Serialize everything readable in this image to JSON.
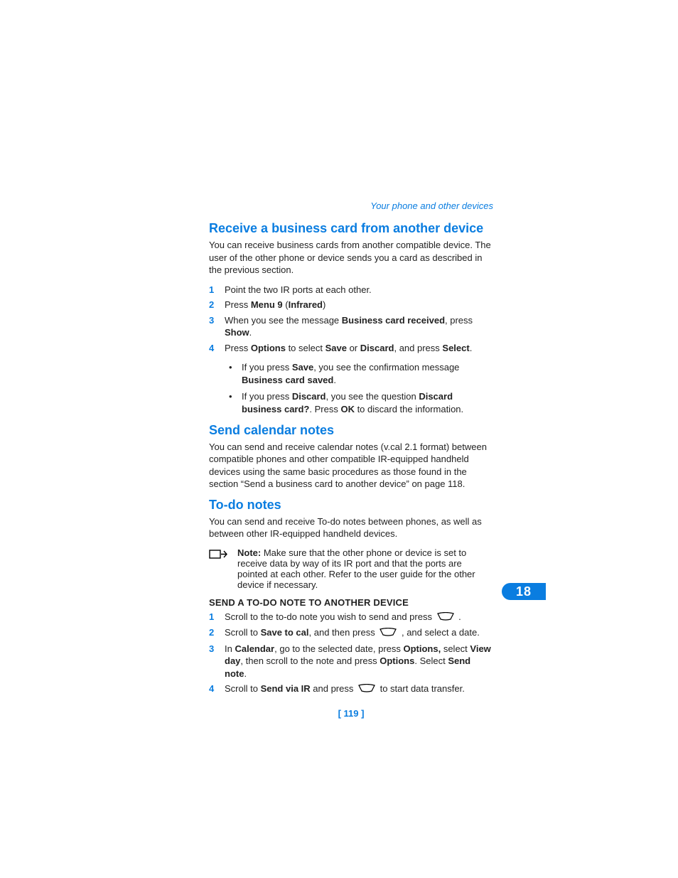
{
  "header": "Your phone and other devices",
  "chapter_badge": "18",
  "page_number": "[ 119 ]",
  "s1": {
    "title": "Receive a business card from another device",
    "intro": "You can receive business cards from another compatible device. The user of the other phone or device sends you a card as described in the previous section.",
    "step1": "Point the two IR ports at each other.",
    "step2_a": "Press ",
    "step2_b": "Menu 9",
    "step2_c": " (",
    "step2_d": "Infrared",
    "step2_e": ")",
    "step3_a": "When you see the message ",
    "step3_b": "Business card received",
    "step3_c": ", press ",
    "step3_d": "Show",
    "step3_e": ".",
    "step4_a": "Press ",
    "step4_b": "Options",
    "step4_c": " to select ",
    "step4_d": "Save",
    "step4_e": " or ",
    "step4_f": "Discard",
    "step4_g": ", and press ",
    "step4_h": "Select",
    "step4_i": ".",
    "b1_a": "If you press ",
    "b1_b": "Save",
    "b1_c": ", you see the confirmation message ",
    "b1_d": "Business card saved",
    "b1_e": ".",
    "b2_a": "If you press ",
    "b2_b": "Discard",
    "b2_c": ", you see the question ",
    "b2_d": "Discard business card?",
    "b2_e": ". Press ",
    "b2_f": "OK",
    "b2_g": " to discard the information."
  },
  "s2": {
    "title": "Send calendar notes",
    "body": "You can send and receive calendar notes (v.cal 2.1 format) between compatible phones and other compatible IR-equipped handheld devices using the same basic procedures as those found in the section “Send a business card to another device” on page 118."
  },
  "s3": {
    "title": "To-do notes",
    "intro": "You can send and receive To-do notes between phones, as well as between other IR-equipped handheld devices.",
    "note_label": "Note:",
    "note_body": " Make sure that the other phone or device is set to receive data by way of its IR port and that the ports are pointed at each other. Refer to the user guide for the other device if necessary.",
    "subhead": "SEND A TO-DO NOTE TO ANOTHER DEVICE",
    "step1_a": "Scroll to the to-do note you wish to send and press ",
    "step1_b": " .",
    "step2_a": "Scroll to ",
    "step2_b": "Save to cal",
    "step2_c": ", and then press  ",
    "step2_d": " , and select a date.",
    "step3_a": "In ",
    "step3_b": "Calendar",
    "step3_c": ", go to the selected date, press ",
    "step3_d": "Options,",
    "step3_e": " select ",
    "step3_f": "View day",
    "step3_g": ", then scroll to the note and press ",
    "step3_h": "Options",
    "step3_i": ". Select ",
    "step3_j": "Send note",
    "step3_k": ".",
    "step4_a": "Scroll to ",
    "step4_b": "Send via IR",
    "step4_c": " and press ",
    "step4_d": " to start data transfer."
  },
  "nums": {
    "n1": "1",
    "n2": "2",
    "n3": "3",
    "n4": "4"
  },
  "bullet": "•"
}
